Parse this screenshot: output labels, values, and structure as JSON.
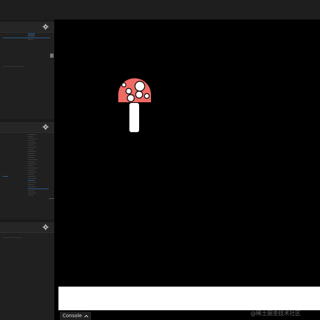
{
  "console": {
    "tab_label": "Console"
  },
  "watermark": {
    "text": "@稀土掘金技术社区"
  },
  "icons": [
    "gear-icon",
    "chevron-up-icon",
    "mushroom"
  ],
  "colors": {
    "mushroom_cap": "#f06a64",
    "mushroom_spots": "#ffffff",
    "mushroom_stem": "#ffffff",
    "stage_bg": "#000000"
  }
}
